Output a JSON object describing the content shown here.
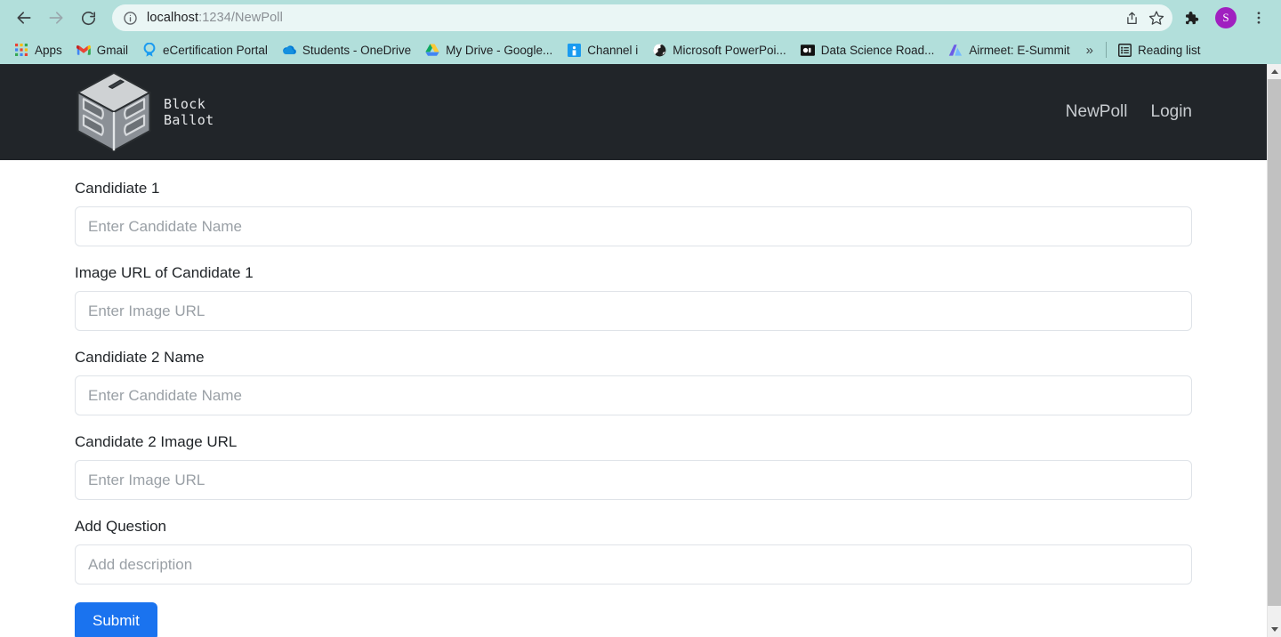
{
  "browser": {
    "back_icon": "arrow-left-icon",
    "forward_icon": "arrow-right-icon",
    "reload_icon": "reload-icon",
    "site_info_icon": "info-circle-icon",
    "url_host": "localhost",
    "url_path": ":1234/NewPoll",
    "url_full": "localhost:1234/NewPoll",
    "share_icon": "share-icon",
    "bookmark_star_icon": "star-icon",
    "extensions_icon": "puzzle-piece-icon",
    "profile_initial": "S",
    "menu_icon": "three-dot-menu-icon",
    "bookmarks": [
      {
        "label": "Apps",
        "icon": "apps-grid-icon"
      },
      {
        "label": "Gmail",
        "icon": "gmail-icon"
      },
      {
        "label": "eCertification Portal",
        "icon": "ribbon-badge-icon"
      },
      {
        "label": "Students - OneDrive",
        "icon": "onedrive-cloud-icon"
      },
      {
        "label": "My Drive - Google...",
        "icon": "google-drive-icon"
      },
      {
        "label": "Channel i",
        "icon": "channel-i-icon"
      },
      {
        "label": "Microsoft PowerPoi...",
        "icon": "powerpoint-globe-icon"
      },
      {
        "label": "Data Science Road...",
        "icon": "data-science-icon"
      },
      {
        "label": "Airmeet: E-Summit",
        "icon": "airmeet-icon"
      }
    ],
    "overflow_label": "»",
    "reading_list_label": "Reading list",
    "reading_list_icon": "reading-list-icon"
  },
  "site": {
    "brand_line1": "Block",
    "brand_line2": "Ballot",
    "logo_icon": "ballot-box-cube-logo",
    "navbar_bg": "#212529",
    "navlinks": [
      {
        "label": "NewPoll"
      },
      {
        "label": "Login"
      }
    ]
  },
  "form": {
    "fields": [
      {
        "label": "Candidiate 1",
        "placeholder": "Enter Candidate Name",
        "value": "",
        "name": "candidate-1-name-input"
      },
      {
        "label": "Image URL of Candidate 1",
        "placeholder": "Enter Image URL",
        "value": "",
        "name": "candidate-1-image-url-input"
      },
      {
        "label": "Candidiate 2 Name",
        "placeholder": "Enter Candidate Name",
        "value": "",
        "name": "candidate-2-name-input"
      },
      {
        "label": "Candidate 2 Image URL",
        "placeholder": "Enter Image URL",
        "value": "",
        "name": "candidate-2-image-url-input"
      },
      {
        "label": "Add Question",
        "placeholder": "Add description",
        "value": "",
        "name": "question-description-input"
      }
    ],
    "submit_label": "Submit",
    "submit_color": "#1a73ef"
  },
  "scrollbar": {
    "up_icon": "scroll-up-arrow-icon",
    "down_icon": "scroll-down-arrow-icon"
  }
}
